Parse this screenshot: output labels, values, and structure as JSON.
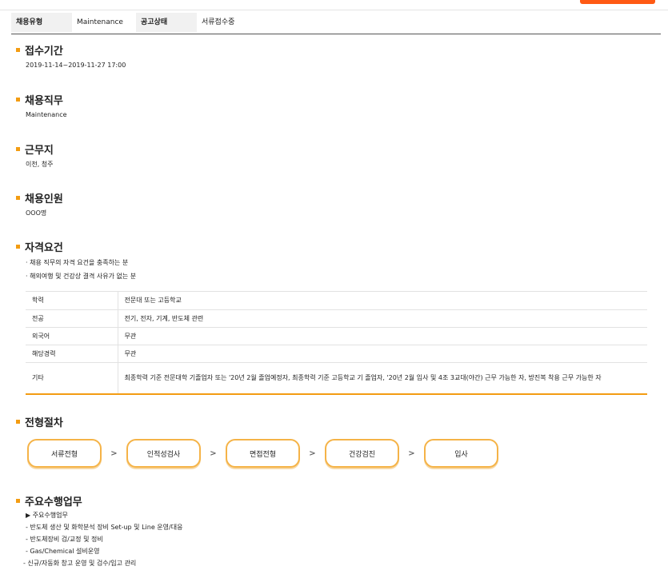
{
  "info": {
    "type_label": "채용유형",
    "type_value": "Maintenance",
    "status_label": "공고상태",
    "status_value": "서류접수중"
  },
  "sections": {
    "period": {
      "title": "접수기간",
      "body": "2019-11-14~2019-11-27 17:00"
    },
    "job": {
      "title": "채용직무",
      "body": "Maintenance"
    },
    "location": {
      "title": "근무지",
      "body": "이천, 청주"
    },
    "headcount": {
      "title": "채용인원",
      "body": "OOO명"
    },
    "qualification": {
      "title": "자격요건",
      "bullets": [
        "· 채용 직무의 자격 요건을 충족하는 분",
        "· 해외여행 및 건강상 결격 사유가 없는 분"
      ]
    },
    "process": {
      "title": "전형절차"
    },
    "duties": {
      "title": "주요수행업무"
    }
  },
  "requirements_table": [
    {
      "label": "학력",
      "value": "전문대 또는 고등학교"
    },
    {
      "label": "전공",
      "value": "전기, 전자, 기계, 반도체 관련"
    },
    {
      "label": "외국어",
      "value": "무관"
    },
    {
      "label": "해당경력",
      "value": "무관"
    },
    {
      "label": "기타",
      "value": "최종학력 기준 전문대학 기졸업자 또는 '20년 2월 졸업예정자, 최종학력 기준 고등학교 기 졸업자, '20년 2월 입사 및 4조 3교대(야간) 근무 가능한 자, 방진복 착용 근무 가능한 자"
    }
  ],
  "steps": [
    "서류전형",
    "인적성검사",
    "면접전형",
    "건강검진",
    "입사"
  ],
  "arrow_glyph": ">",
  "duties": [
    "▶ 주요수행업무",
    "- 반도체 생산 및 화학분석 장비 Set-up 및 Line 운영/대응",
    "- 반도체장비 검/교정 및 정비",
    "- Gas/Chemical 설비운영",
    "- 신규/자동화 창고 운영 및 검수/입고 관리"
  ],
  "colors": {
    "accent": "#f39c12",
    "button": "#ff5a14"
  }
}
